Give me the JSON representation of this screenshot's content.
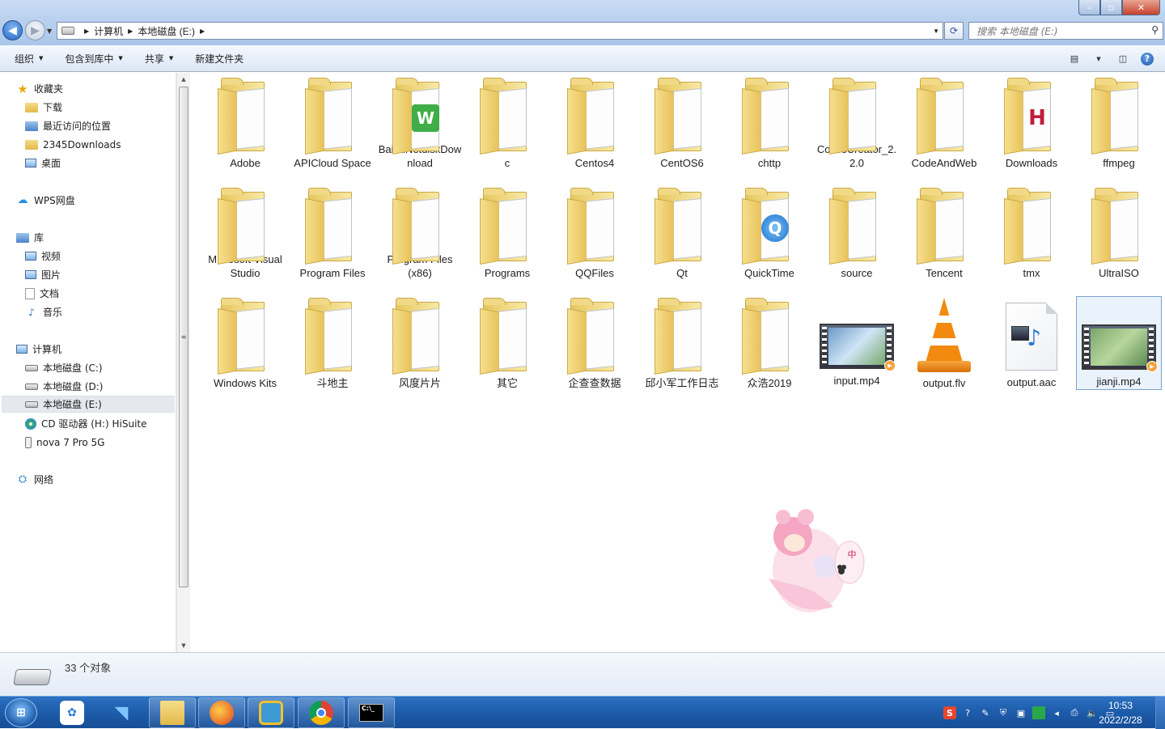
{
  "window": {
    "min": "–",
    "max": "▫",
    "close": "✕"
  },
  "address": {
    "crumbs": [
      "计算机",
      "本地磁盘 (E:)"
    ]
  },
  "search": {
    "placeholder": "搜索 本地磁盘 (E:)"
  },
  "toolbar": {
    "organize": "组织",
    "include_library": "包含到库中",
    "share": "共享",
    "new_folder": "新建文件夹"
  },
  "sidebar": {
    "favorites": "收藏夹",
    "fav_items": [
      "下载",
      "最近访问的位置",
      "2345Downloads",
      "桌面"
    ],
    "wps": "WPS网盘",
    "libraries": "库",
    "lib_items": [
      "视频",
      "图片",
      "文档",
      "音乐"
    ],
    "computer": "计算机",
    "comp_items": [
      "本地磁盘 (C:)",
      "本地磁盘 (D:)",
      "本地磁盘 (E:)",
      "CD 驱动器 (H:) HiSuite",
      "nova 7 Pro 5G"
    ],
    "network": "网络"
  },
  "files": [
    {
      "name": "Adobe",
      "kind": "folder"
    },
    {
      "name": "APICloud Space",
      "kind": "folder"
    },
    {
      "name": "BaiduNetdiskDownload",
      "kind": "folder",
      "badge": "wps"
    },
    {
      "name": "c",
      "kind": "folder"
    },
    {
      "name": "Centos4",
      "kind": "folder"
    },
    {
      "name": "CentOS6",
      "kind": "folder"
    },
    {
      "name": "chttp",
      "kind": "folder"
    },
    {
      "name": "CocosCreator_2.2.0",
      "kind": "folder"
    },
    {
      "name": "CodeAndWeb",
      "kind": "folder"
    },
    {
      "name": "Downloads",
      "kind": "folder",
      "badge": "hd"
    },
    {
      "name": "ffmpeg",
      "kind": "folder"
    },
    {
      "name": "Microsoft Visual Studio",
      "kind": "folder"
    },
    {
      "name": "Program Files",
      "kind": "folder"
    },
    {
      "name": "Program Files (x86)",
      "kind": "folder"
    },
    {
      "name": "Programs",
      "kind": "folder"
    },
    {
      "name": "QQFiles",
      "kind": "folder"
    },
    {
      "name": "Qt",
      "kind": "folder"
    },
    {
      "name": "QuickTime",
      "kind": "folder",
      "badge": "qt"
    },
    {
      "name": "source",
      "kind": "folder"
    },
    {
      "name": "Tencent",
      "kind": "folder"
    },
    {
      "name": "tmx",
      "kind": "folder"
    },
    {
      "name": "UltraISO",
      "kind": "folder"
    },
    {
      "name": "Windows Kits",
      "kind": "folder"
    },
    {
      "name": "斗地主",
      "kind": "folder"
    },
    {
      "name": "风度片片",
      "kind": "folder"
    },
    {
      "name": "其它",
      "kind": "folder"
    },
    {
      "name": "企查查数据",
      "kind": "folder"
    },
    {
      "name": "邱小军工作日志",
      "kind": "folder"
    },
    {
      "name": "众浩2019",
      "kind": "folder"
    },
    {
      "name": "input.mp4",
      "kind": "video"
    },
    {
      "name": "output.flv",
      "kind": "vlc"
    },
    {
      "name": "output.aac",
      "kind": "audio"
    },
    {
      "name": "jianji.mp4",
      "kind": "video",
      "selected": true
    }
  ],
  "mascot": {
    "badge": "中"
  },
  "status": {
    "count": "33 个对象"
  },
  "taskbar": {
    "time": "10:53",
    "date": "2022/2/28"
  },
  "colors": {
    "accent": "#2566c4",
    "selection": "#eaf2fb",
    "folder": "#e8c25a"
  }
}
